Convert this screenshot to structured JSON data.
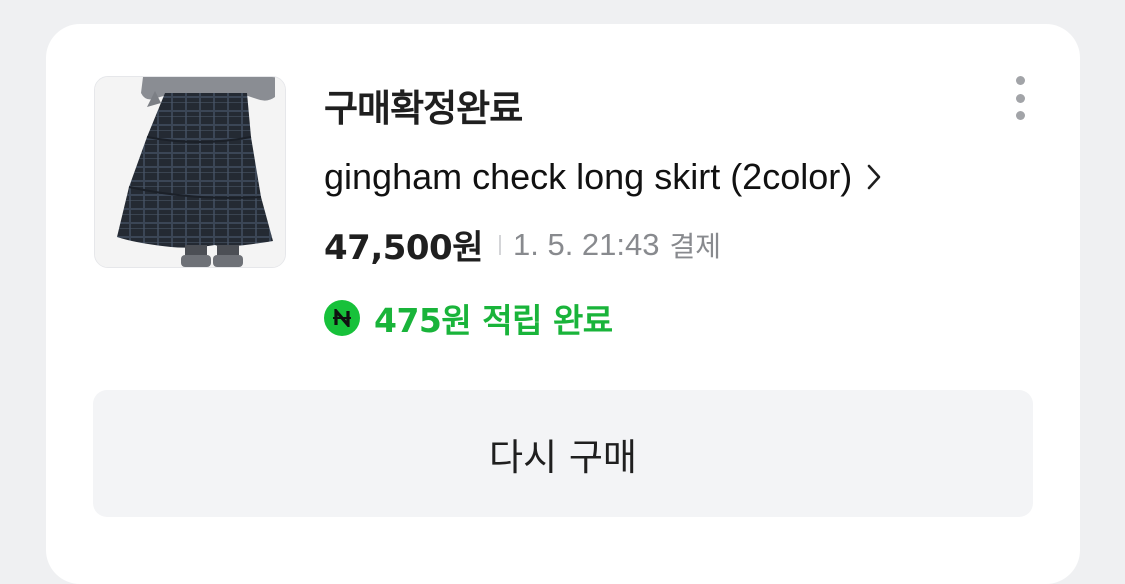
{
  "order": {
    "status": "구매확정완료",
    "product_name": "gingham check long skirt (2color)",
    "price": "47,500원",
    "paid_date": "1. 5. 21:43",
    "paid_word": "결제",
    "points_text": "475원 적립 완료",
    "rebuy_label": "다시 구매"
  },
  "icons": {
    "thumbnail": "product-photo-skirt",
    "more": "vertical-ellipsis-icon",
    "chevron": "chevron-right-icon",
    "points": "naver-pay-n-icon"
  },
  "colors": {
    "background": "#eff0f2",
    "card": "#ffffff",
    "points_green": "#19b43a",
    "npay_badge": "#17c13a",
    "muted_text": "#888a8e",
    "button_bg": "#f3f4f6"
  }
}
